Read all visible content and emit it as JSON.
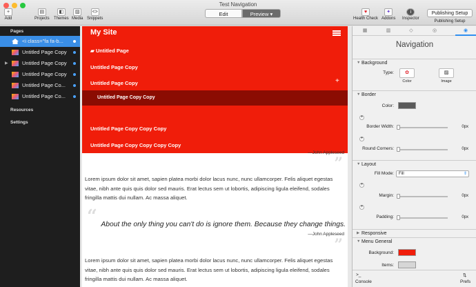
{
  "window": {
    "title": "Test Navigation"
  },
  "toolbar": {
    "add": "Add",
    "projects": "Projects",
    "themes": "Themes",
    "media": "Media",
    "snippets": "Snippets",
    "edit": "Edit",
    "preview": "Preview",
    "health": "Health Check",
    "addons": "Addons",
    "inspector": "Inspector",
    "publish_btn": "Publishing Setup",
    "publish_label": "Publishing Setup"
  },
  "sidebar": {
    "pages_header": "Pages",
    "pages": [
      {
        "label": "<i class=\"fa fa-b..."
      },
      {
        "label": "Untitled Page Copy"
      },
      {
        "label": "Untitled Page Copy"
      },
      {
        "label": "Untitled Page Copy"
      },
      {
        "label": "Untitled Page Co..."
      },
      {
        "label": "Untitled Page Co..."
      }
    ],
    "resources": "Resources",
    "settings": "Settings"
  },
  "preview": {
    "site_title": "My Site",
    "nav": [
      "Untitled Page",
      "Untitled Page Copy",
      "Untitled Page Copy",
      "Untitled Page Copy Copy",
      "Untitled Page Copy Copy Copy",
      "Untitled Page Copy Copy Copy Copy"
    ],
    "cite1": "—John Appleseed",
    "para1": "Lorem ipsum dolor sit amet, sapien platea morbi dolor lacus nunc, nunc ullamcorper. Felis aliquet egestas vitae, nibh ante quis quis dolor sed mauris. Erat lectus sem ut lobortis, adipiscing ligula eleifend, sodales fringilla mattis dui nullam. Ac massa aliquet.",
    "quote": "About the only thing you can't do is ignore them. Because they change things.",
    "cite2": "—John Appleseed",
    "para2": "Lorem ipsum dolor sit amet, sapien platea morbi dolor lacus nunc, nunc ullamcorper. Felis aliquet egestas vitae, nibh ante quis quis dolor sed mauris. Erat lectus sem ut lobortis, adipiscing ligula eleifend, sodales fringilla mattis dui nullam. Ac massa aliquet."
  },
  "inspector": {
    "title": "Navigation",
    "background": "Background",
    "type": "Type:",
    "color_opt": "Color",
    "image_opt": "Image",
    "border": "Border",
    "color": "Color:",
    "border_width": "Border Width:",
    "bw_val": "0px",
    "round_corners": "Round Corners:",
    "rc_val": "0px",
    "layout": "Layout",
    "fill_mode": "Fill Mode:",
    "fill_val": "Fill",
    "margin": "Margin:",
    "margin_val": "0px",
    "padding": "Padding:",
    "padding_val": "0px",
    "responsive": "Responsive",
    "menu_general": "Menu General",
    "bg_label": "Background:",
    "items_label": "Items:",
    "console": "Console",
    "prefs": "Prefs"
  },
  "colors": {
    "nav_red": "#f01d0a",
    "nav_sub": "#8b0c02",
    "accent": "#3a8ee6"
  }
}
